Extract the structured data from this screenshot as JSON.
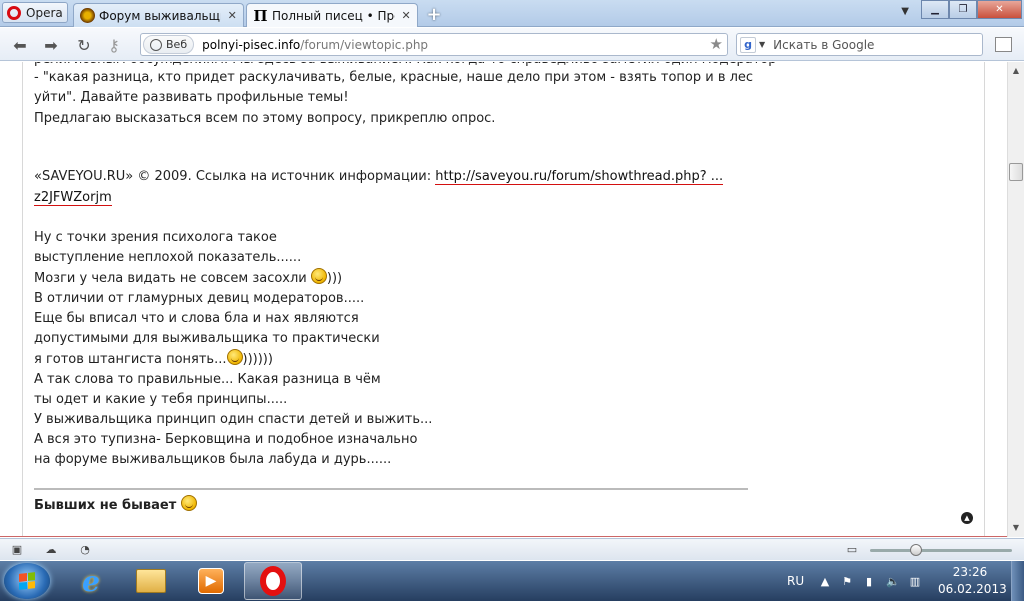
{
  "browser": {
    "menu_label": "Opera",
    "tabs": [
      {
        "label": "Форум выживальщик...",
        "active": false
      },
      {
        "label": "Полный писец • Прос...",
        "active": true
      }
    ],
    "favicon_letter": "П",
    "address": {
      "security_label": "Веб",
      "host": "polnyi-pisec.info",
      "path": "/forum/viewtopic.php"
    },
    "search": {
      "engine_icon": "g",
      "placeholder": "Искать в Google"
    }
  },
  "post": {
    "lines_top": [
      "религиозным обсуждениям. Мы здесь за выживанием. Как когда-то справедливо заметил один модератор",
      "- \"какая разница, кто придет раскулачивать, белые, красные, наше дело при этом - взять топор и в лес",
      "уйти\". Давайте развивать профильные темы!",
      "Предлагаю высказаться всем по этому вопросу, прикреплю опрос."
    ],
    "source_prefix": "«SAVEYOU.RU» © 2009. Ссылка на источник информации:",
    "source_link_1": "http://saveyou.ru/forum/showthread.php? ...",
    "source_link_2": "z2JFWZorjm",
    "reply": [
      {
        "text": "Ну с точки зрения психолога такое"
      },
      {
        "text": "выступление неплохой показатель......"
      },
      {
        "text": "Мозги у чела видать не совсем засохли",
        "after_smiley": ")))"
      },
      {
        "text": "В отличии от гламурных девиц модераторов....."
      },
      {
        "text": "Еще бы вписал что и слова бла и нах являются"
      },
      {
        "text": "допустимыми для выживальщика то практически"
      },
      {
        "text": "я готов штангиста понять...",
        "after_smiley": "))))))"
      },
      {
        "text": "А так слова то правильные... Какая разница в чём"
      },
      {
        "text": "ты одет и какие у тебя принципы....."
      },
      {
        "text": "У выживальщика принцип один спасти детей и выжить..."
      },
      {
        "text": "А вся это тупизна- Берковщина и подобное изначально"
      },
      {
        "text": "на форуме выживальщиков была лабуда и дурь......"
      }
    ],
    "signature": "Бывших не бывает"
  },
  "taskbar": {
    "language": "RU",
    "time": "23:26",
    "date": "06.02.2013"
  },
  "colors": {
    "link_underline": "#d31010",
    "opera_red": "#e41010",
    "taskbar": "#263e60"
  }
}
